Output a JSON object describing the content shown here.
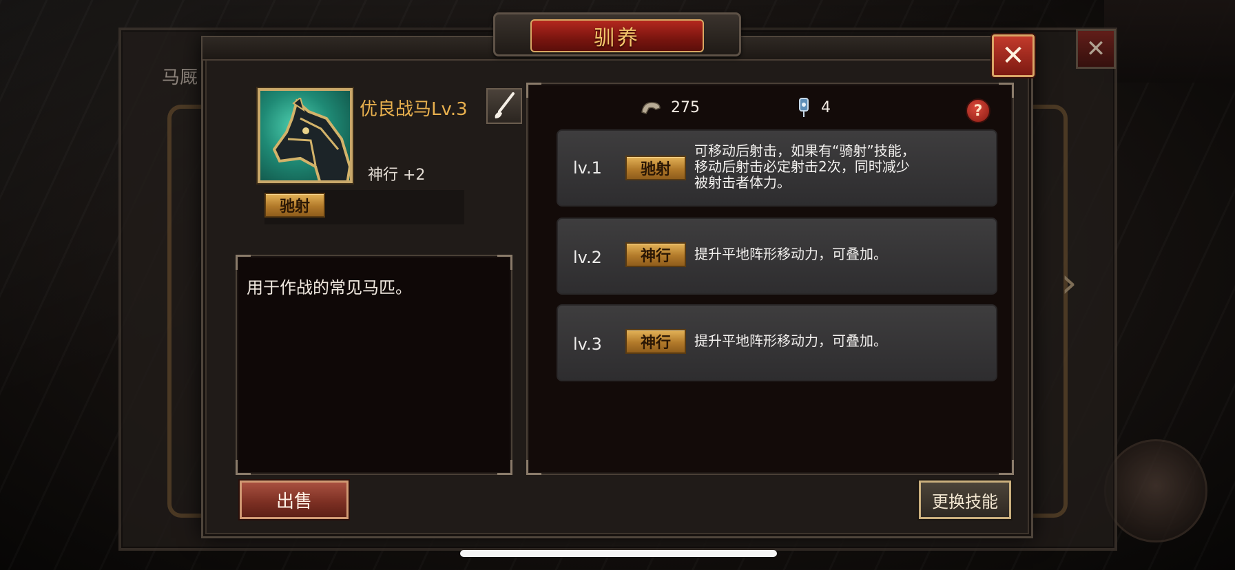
{
  "background": {
    "stable_title": "马厩"
  },
  "dialog": {
    "title": "驯养",
    "close_label": "✕"
  },
  "horse": {
    "name": "优良战马Lv.3",
    "stat": "神行 +2",
    "skill": "驰射",
    "description": "用于作战的常见马匹。"
  },
  "resources": {
    "hoof_value": "275",
    "token_value": "4",
    "help_label": "?"
  },
  "levels": [
    {
      "label": "lv.1",
      "skill": "驰射",
      "desc": "可移动后射击，如果有“骑射”技能，\n移动后射击必定射击2次，同时减少\n被射击者体力。"
    },
    {
      "label": "lv.2",
      "skill": "神行",
      "desc": "提升平地阵形移动力，可叠加。"
    },
    {
      "label": "lv.3",
      "skill": "神行",
      "desc": "提升平地阵形移动力，可叠加。"
    }
  ],
  "buttons": {
    "sell": "出售",
    "change_skill": "更换技能"
  },
  "colors": {
    "accent_gold": "#e8b04e",
    "close_red": "#c23a2b",
    "card_bg": "#3e3d3e"
  }
}
